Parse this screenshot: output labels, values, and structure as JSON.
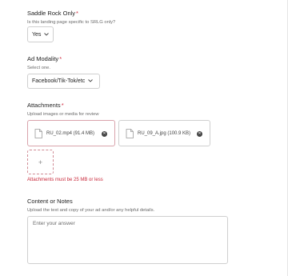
{
  "saddle": {
    "label": "Saddle Rock Only",
    "required_mark": "*",
    "help": "Is this landing page specific to SRLG only?",
    "value": "Yes"
  },
  "ad_modality": {
    "label": "Ad Modality",
    "required_mark": "*",
    "help": "Select one.",
    "value": "Facebook/Tik-Tok/etc"
  },
  "attachments": {
    "label": "Attachments",
    "required_mark": "*",
    "help": "Upload images or media for review",
    "files": [
      {
        "name": "RU_02.mp4 (91.4 MB)",
        "state": "error"
      },
      {
        "name": "RU_09_A.jpg (100.9 KB)",
        "state": "normal"
      }
    ],
    "add_label": "+",
    "error": "Attachments must be 25 MB or less"
  },
  "content": {
    "label": "Content or Notes",
    "help": "Upload the text and copy of your ad and/or any helpful details.",
    "placeholder": "Enter your answer"
  },
  "colors": {
    "required": "#d0283c",
    "error_border": "#d9a3ab",
    "error_text": "#c8283a"
  },
  "icons": [
    "chevron-down-icon",
    "file-icon",
    "close-icon",
    "plus-icon"
  ]
}
